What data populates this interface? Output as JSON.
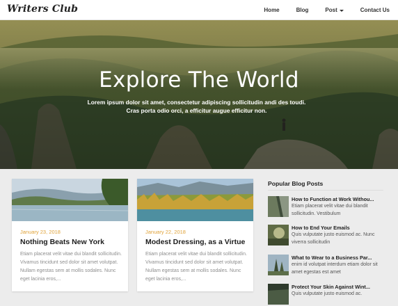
{
  "header": {
    "logo": "Writers Club",
    "nav": [
      {
        "label": "Home"
      },
      {
        "label": "Blog"
      },
      {
        "label": "Post"
      },
      {
        "label": "Contact Us"
      }
    ]
  },
  "hero": {
    "title": "Explore The World",
    "subtitle_line1": "Lorem ipsum dolor sit amet, consectetur adipiscing sollicitudin andi des toudi.",
    "subtitle_line2": "Cras porta odio orci, a efficitur augue efficitur non."
  },
  "cards": [
    {
      "date": "January 23, 2018",
      "title": "Nothing Beats New York",
      "excerpt": "Etiam placerat velit vitae dui blandit sollicitudin. Vivamus tincidunt sed dolor sit amet volutpat. Nullam egestas sem at mollis sodales. Nunc eget lacinia eros,..."
    },
    {
      "date": "January 22, 2018",
      "title": "Modest Dressing, as a Virtue",
      "excerpt": "Etiam placerat velit vitae dui blandit sollicitudin. Vivamus tincidunt sed dolor sit amet volutpat. Nullam egestas sem at mollis sodales. Nunc eget lacinia eros,..."
    }
  ],
  "sidebar": {
    "title": "Popular Blog Posts",
    "posts": [
      {
        "title": "How to Function at Work Withou...",
        "excerpt": "Etiam placerat velit vitae dui blandit sollicitudin. Vestibulum"
      },
      {
        "title": "How to End Your Emails",
        "excerpt": "Quis vulputate justo euismod ac. Nunc viverra sollicitudin"
      },
      {
        "title": "What to Wear to a Business Par...",
        "excerpt": "enim id volutpat interdum etiam dolor sit amet egestas est amet"
      },
      {
        "title": "Protect Your Skin Against Wint...",
        "excerpt": "Quis vulputate justo euismod ac."
      }
    ]
  },
  "colors": {
    "accent_date": "#e0a33a",
    "text_dark": "#1d1d1d",
    "page_bg": "#ececec"
  }
}
